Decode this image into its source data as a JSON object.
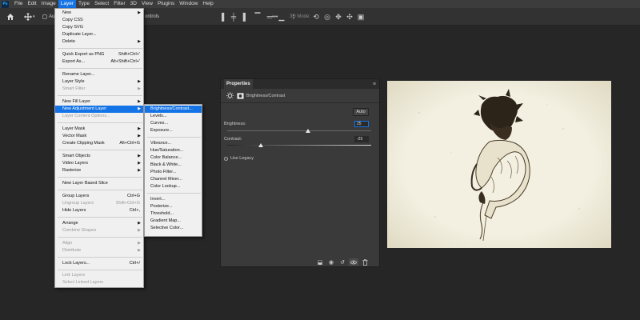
{
  "menubar": {
    "logo": "Ps",
    "items": [
      "File",
      "Edit",
      "Image",
      "Layer",
      "Type",
      "Select",
      "Filter",
      "3D",
      "View",
      "Plugins",
      "Window",
      "Help"
    ]
  },
  "options_bar": {
    "auto_select_label": "Au",
    "controls_label": "ontrols",
    "mode_3d_label": "3D Mode:"
  },
  "layer_menu": {
    "items": [
      {
        "label": "New",
        "submenu": true
      },
      {
        "label": "Copy CSS"
      },
      {
        "label": "Copy SVG"
      },
      {
        "label": "Duplicate Layer..."
      },
      {
        "label": "Delete",
        "submenu": true
      },
      {
        "label": "Quick Export as PNG",
        "shortcut": "Shift+Ctrl+'"
      },
      {
        "label": "Export As...",
        "shortcut": "Alt+Shift+Ctrl+'"
      },
      {
        "label": "Rename Layer..."
      },
      {
        "label": "Layer Style",
        "submenu": true
      },
      {
        "label": "Smart Filter",
        "submenu": true,
        "disabled": true
      },
      {
        "label": "New Fill Layer",
        "submenu": true
      },
      {
        "label": "New Adjustment Layer",
        "submenu": true,
        "highlighted": true
      },
      {
        "label": "Layer Content Options...",
        "disabled": true
      },
      {
        "label": "Layer Mask",
        "submenu": true
      },
      {
        "label": "Vector Mask",
        "submenu": true
      },
      {
        "label": "Create Clipping Mask",
        "shortcut": "Alt+Ctrl+G"
      },
      {
        "label": "Smart Objects",
        "submenu": true
      },
      {
        "label": "Video Layers",
        "submenu": true
      },
      {
        "label": "Rasterize",
        "submenu": true
      },
      {
        "label": "New Layer Based Slice"
      },
      {
        "label": "Group Layers",
        "shortcut": "Ctrl+G"
      },
      {
        "label": "Ungroup Layers",
        "shortcut": "Shift+Ctrl+G",
        "disabled": true
      },
      {
        "label": "Hide Layers",
        "shortcut": "Ctrl+,"
      },
      {
        "label": "Arrange",
        "submenu": true
      },
      {
        "label": "Combine Shapes",
        "submenu": true,
        "disabled": true
      },
      {
        "label": "Align",
        "submenu": true,
        "disabled": true
      },
      {
        "label": "Distribute",
        "submenu": true,
        "disabled": true
      },
      {
        "label": "Lock Layers...",
        "shortcut": "Ctrl+/"
      },
      {
        "label": "Link Layers",
        "disabled": true
      },
      {
        "label": "Select Linked Layers",
        "disabled": true
      }
    ]
  },
  "adjustment_menu": {
    "items": [
      {
        "label": "Brightness/Contrast...",
        "highlighted": true
      },
      {
        "label": "Levels..."
      },
      {
        "label": "Curves..."
      },
      {
        "label": "Exposure..."
      },
      {
        "label": "Vibrance..."
      },
      {
        "label": "Hue/Saturation..."
      },
      {
        "label": "Color Balance..."
      },
      {
        "label": "Black & White..."
      },
      {
        "label": "Photo Filter..."
      },
      {
        "label": "Channel Mixer..."
      },
      {
        "label": "Color Lookup..."
      },
      {
        "label": "Invert..."
      },
      {
        "label": "Posterize..."
      },
      {
        "label": "Threshold..."
      },
      {
        "label": "Gradient Map..."
      },
      {
        "label": "Selective Color..."
      }
    ]
  },
  "properties": {
    "tab_title": "Properties",
    "adjustment_title": "Brightness/Contrast",
    "auto_label": "Auto",
    "brightness_label": "Brightness:",
    "brightness_value": "25",
    "contrast_label": "Contrast:",
    "contrast_value": "-25",
    "use_legacy_label": "Use Legacy"
  },
  "colors": {
    "menu_highlight": "#1473e6",
    "app_background": "#262626",
    "panel_background": "#3a3a3a"
  }
}
